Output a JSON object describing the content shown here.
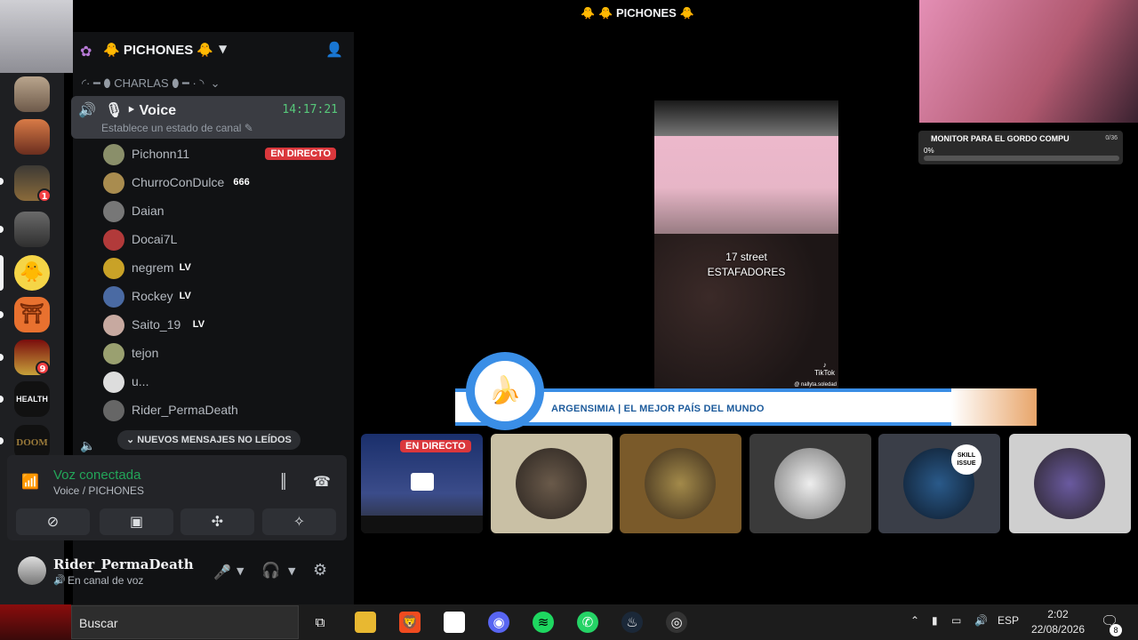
{
  "server": {
    "name": "PICHONES",
    "category": "CHARLAS"
  },
  "voice_channel": {
    "name": "Voice",
    "time": "14:17:21",
    "status_placeholder": "Establece un estado de canal"
  },
  "members": [
    {
      "name": "Pichonn11",
      "live": "EN DIRECTO",
      "color": "#8a8f6a"
    },
    {
      "name": "ChurroConDulce",
      "tag": "666",
      "color": "#a98c4f"
    },
    {
      "name": "Daian",
      "color": "#777777"
    },
    {
      "name": "Docai7L",
      "color": "#b23a3a"
    },
    {
      "name": "negrem",
      "tag": "LV",
      "color": "#c9a227"
    },
    {
      "name": "Rockey",
      "tag": "LV",
      "color": "#4a6aa3"
    },
    {
      "name": "Saito_19",
      "tag": "LV",
      "color": "#c7a9a0"
    },
    {
      "name": "tejon",
      "color": "#9aa070"
    },
    {
      "name": "u...",
      "color": "#dddddd"
    },
    {
      "name": "Rider_PermaDeath",
      "color": "#666666"
    }
  ],
  "unread_banner": "NUEVOS MENSAJES NO LEÍDOS",
  "voice_panel": {
    "title": "Voz conectada",
    "subtitle": "Voice / PICHONES"
  },
  "user_panel": {
    "username": "Rider_PermaDeath",
    "status": "En canal de voz"
  },
  "rail_badges": {
    "badge1": "1",
    "badge2": "9",
    "health_label": "HEALTH",
    "doom_label": "DOOM"
  },
  "stage": {
    "title": "PICHONES",
    "goal_title": "MONITOR PARA EL GORDO COMPU",
    "goal_count": "0/36",
    "goal_pct": "0%",
    "goal_progress": 0.0,
    "video_text_line1": "17 street",
    "video_text_line2": "ESTAFADORES",
    "video_watermark": "TikTok",
    "video_handle": "@ nallyta.soledad",
    "banner_text": "ARGENSIMIA | EL MEJOR PAÍS DEL MUNDO",
    "tile_live": "EN DIRECTO",
    "skill_issue": "SKILL ISSUE"
  },
  "taskbar": {
    "search": "Buscar",
    "lang": "ESP",
    "time": "2:02",
    "date": "22/08/2026",
    "notif_count": "8"
  },
  "colors": {
    "accent_green": "#23a559",
    "live_red": "#da373c",
    "banner_blue": "#3a8ee6"
  }
}
